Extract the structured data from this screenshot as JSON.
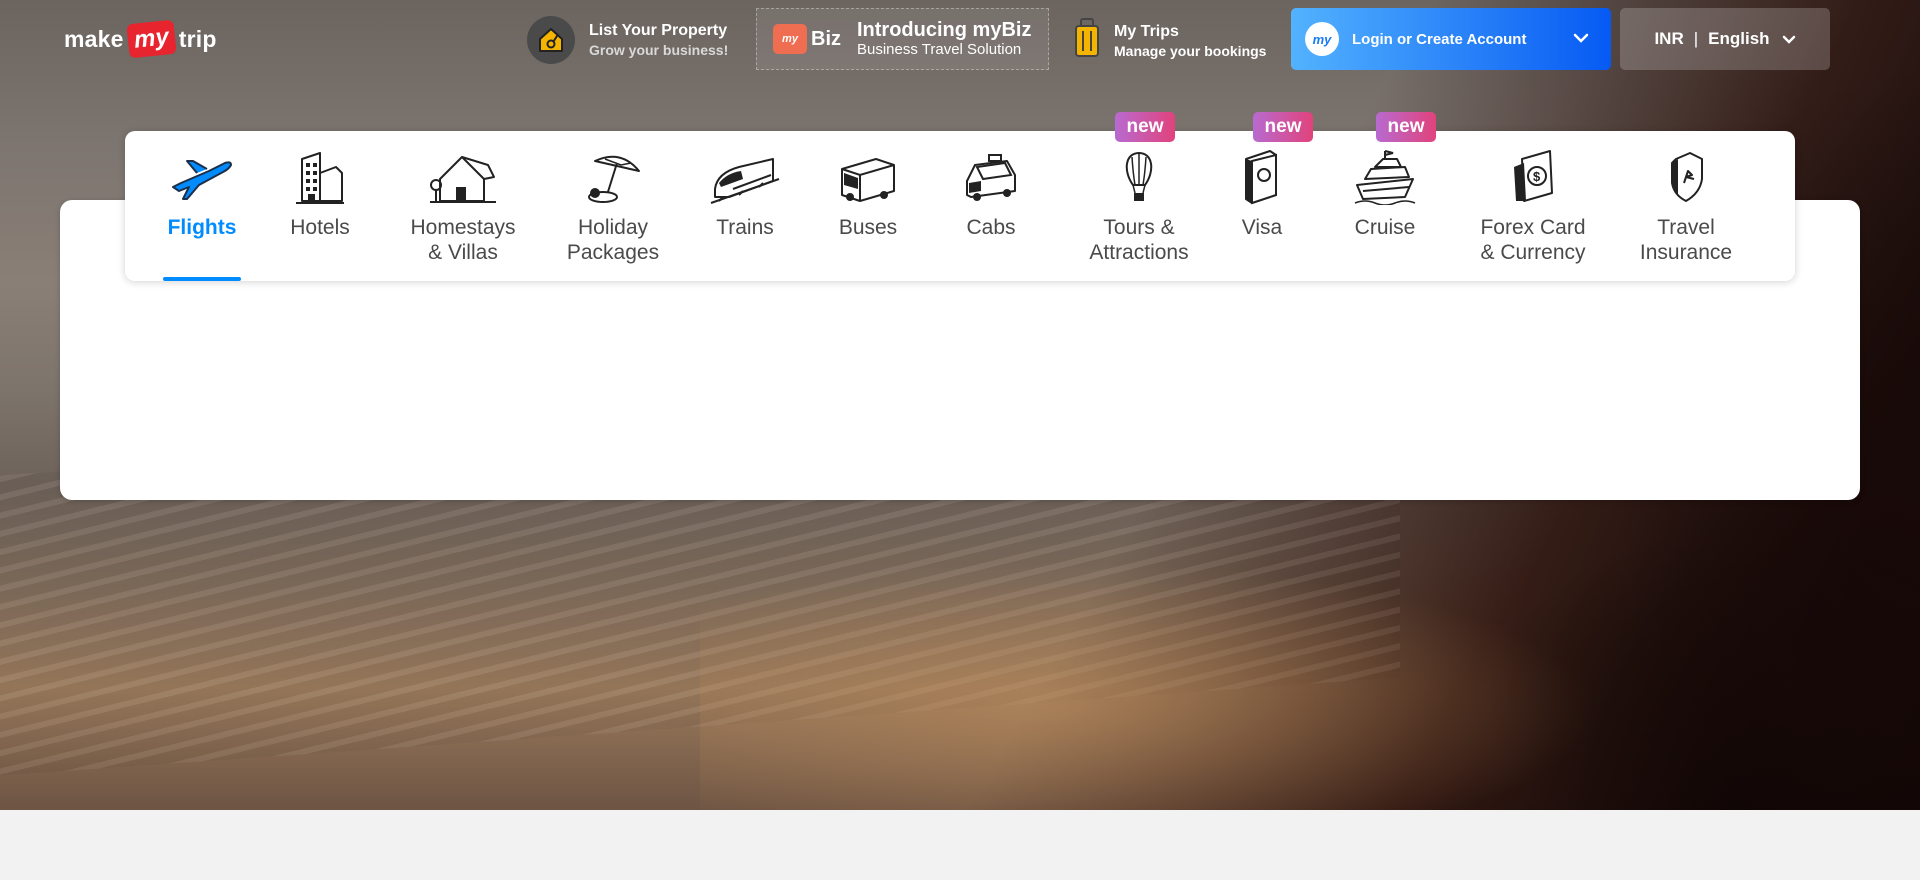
{
  "brand": {
    "left": "make",
    "middle": "my",
    "right": "trip"
  },
  "header": {
    "list_property": {
      "title": "List Your Property",
      "subtitle": "Grow your business!"
    },
    "mybiz": {
      "badge": "Biz",
      "badge_small": "my",
      "title": "Introducing myBiz",
      "subtitle": "Business Travel Solution"
    },
    "my_trips": {
      "title": "My Trips",
      "subtitle": "Manage your bookings"
    },
    "login": {
      "avatar": "my",
      "label": "Login or Create Account"
    },
    "locale": {
      "currency": "INR",
      "separator": "|",
      "language": "English"
    }
  },
  "nav": {
    "badge_text": "new",
    "items": [
      {
        "label": "Flights",
        "icon": "flight-icon",
        "active": true
      },
      {
        "label": "Hotels",
        "icon": "hotel-icon"
      },
      {
        "label": "Homestays\n& Villas",
        "icon": "homestay-icon"
      },
      {
        "label": "Holiday\nPackages",
        "icon": "holiday-icon"
      },
      {
        "label": "Trains",
        "icon": "train-icon"
      },
      {
        "label": "Buses",
        "icon": "bus-icon"
      },
      {
        "label": "Cabs",
        "icon": "cab-icon"
      },
      {
        "label": "Tours &\nAttractions",
        "icon": "balloon-icon",
        "badge": true
      },
      {
        "label": "Visa",
        "icon": "passport-icon",
        "badge": true
      },
      {
        "label": "Cruise",
        "icon": "cruise-icon",
        "badge": true
      },
      {
        "label": "Forex Card\n& Currency",
        "icon": "forex-icon"
      },
      {
        "label": "Travel\nInsurance",
        "icon": "insurance-icon"
      }
    ]
  },
  "colors": {
    "accent": "#008cff",
    "brand_red": "#e8242e",
    "badge_start": "#b86ad0",
    "badge_end": "#e1437c"
  }
}
